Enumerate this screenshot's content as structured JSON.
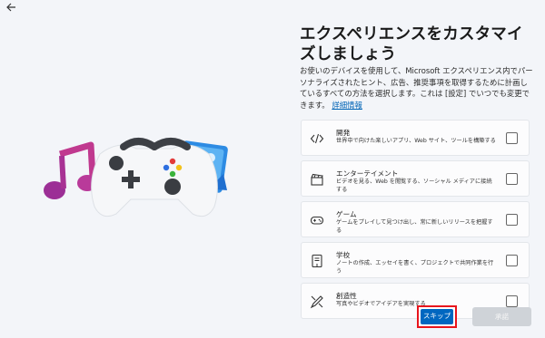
{
  "header": {
    "back_icon": "back-arrow-icon"
  },
  "main": {
    "title": "エクスペリエンスをカスタマイズしましょう",
    "description": "お使いのデバイスを使用して、Microsoft エクスペリエンス内でパーソナライズされたヒント、広告、推奨事項を取得するために計画しているすべての方法を選択します。これは [設定] でいつでも変更できます。",
    "more_info_link": "詳細情報"
  },
  "options": [
    {
      "title": "開発",
      "description": "世界中で向けた楽しいアプリ、Web サイト、ツールを構築する",
      "icon": "code-icon",
      "checked": false
    },
    {
      "title": "エンターテイメント",
      "description": "ビデオを見る、Web を閲覧する、ソーシャル メディアに接続する",
      "icon": "clapperboard-icon",
      "checked": false
    },
    {
      "title": "ゲーム",
      "description": "ゲームをプレイして見つけ出し、常に新しいリリースを把握する",
      "icon": "gamepad-icon",
      "checked": false
    },
    {
      "title": "学校",
      "description": "ノートの作成、エッセイを書く、プロジェクトで共同作業を行う",
      "icon": "notebook-icon",
      "checked": false
    },
    {
      "title": "創造性",
      "description": "写真やビデオでアイデアを実現する",
      "icon": "brush-pencil-icon",
      "checked": false
    }
  ],
  "footer": {
    "skip_label": "スキップ",
    "accept_label": "承諾"
  },
  "colors": {
    "accent": "#0067c0",
    "highlight_border": "#e8141c",
    "background": "#f3f5f9"
  }
}
